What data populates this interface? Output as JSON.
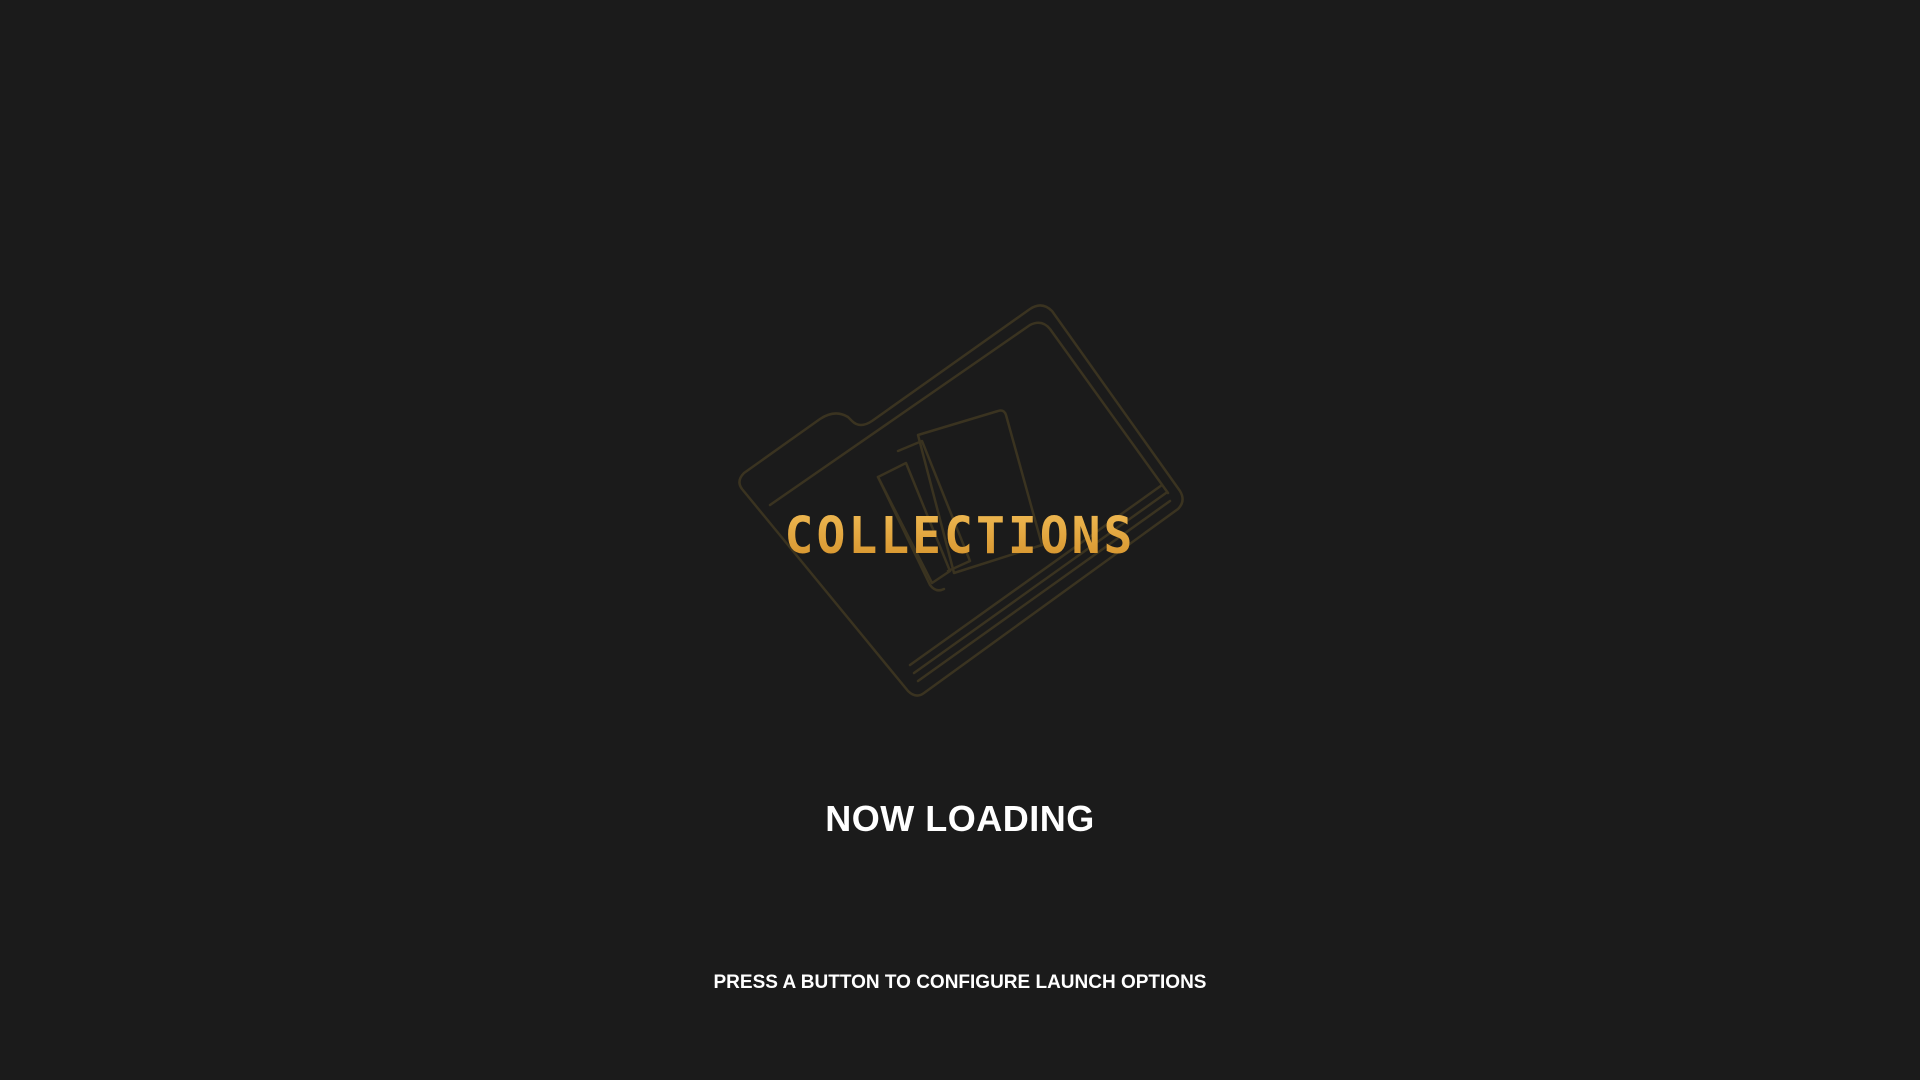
{
  "logo": {
    "text": "COLLECTIONS",
    "icon": "folder-icon",
    "accent_color": "#e3a53c",
    "outline_color": "#3a3320"
  },
  "status": {
    "label": "NOW LOADING"
  },
  "hint": {
    "label": "PRESS A BUTTON TO CONFIGURE LAUNCH OPTIONS"
  },
  "background_color": "#1b1b1b"
}
